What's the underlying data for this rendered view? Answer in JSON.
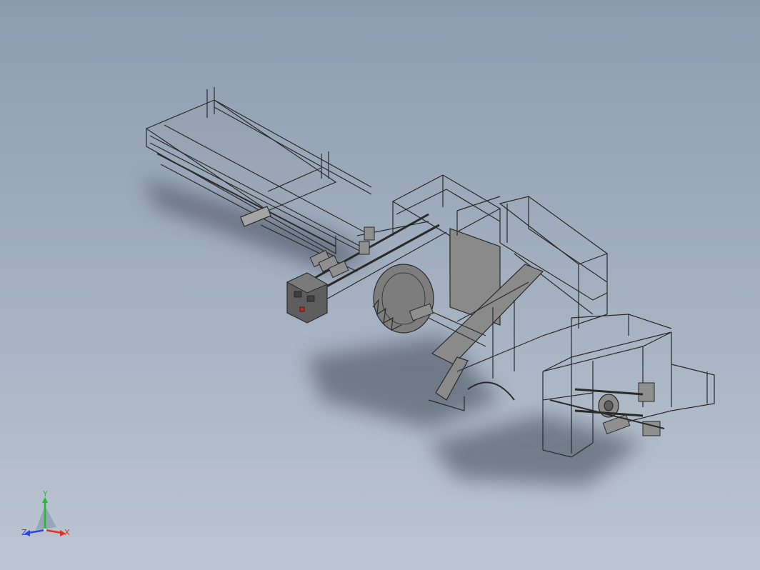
{
  "viewport": {
    "background_top": "#8c9cb0",
    "background_bottom": "#bcc6d2"
  },
  "model": {
    "part_color": "#8a8a8a",
    "edge_color": "#2a2a2a",
    "control_box_color": "#5e5e5e",
    "stop_button_color": "#d0221c"
  },
  "triad": {
    "x_label": "X",
    "y_label": "Y",
    "z_label": "Z",
    "x_color": "#e0302a",
    "y_color": "#1fbf2a",
    "z_color": "#2a43d8"
  }
}
